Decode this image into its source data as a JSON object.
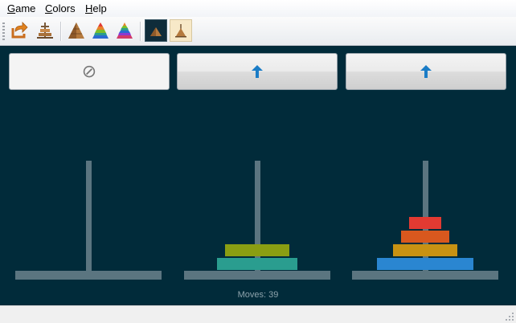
{
  "menu": {
    "items": [
      {
        "accel": "G",
        "rest": "ame"
      },
      {
        "accel": "C",
        "rest": "olors"
      },
      {
        "accel": "H",
        "rest": "elp"
      }
    ]
  },
  "toolbar": {
    "buttons": [
      "undo-icon",
      "add-disk-icon",
      "brown-pyramid-icon",
      "blue-rainbow-pyramid-icon",
      "rainbow-pyramid-icon",
      "dark-theme-icon",
      "light-theme-icon"
    ],
    "selected_theme": "dark-theme-icon"
  },
  "game": {
    "peg_buttons": [
      {
        "state": "disabled",
        "icon": "no-entry-icon",
        "symbol": "⊘"
      },
      {
        "state": "enabled",
        "icon": "arrow-up-icon",
        "symbol": "↑"
      },
      {
        "state": "enabled",
        "icon": "arrow-up-icon",
        "symbol": "↑"
      }
    ],
    "pegs": [
      {
        "disks": []
      },
      {
        "disks": [
          {
            "size": 5,
            "color": "#2a9d8f"
          },
          {
            "size": 4,
            "color": "#8a9e12"
          }
        ]
      },
      {
        "disks": [
          {
            "size": 6,
            "color": "#2a86d1"
          },
          {
            "size": 4,
            "color": "#c89213"
          },
          {
            "size": 3,
            "color": "#d8581e"
          },
          {
            "size": 2,
            "color": "#e23a32"
          }
        ]
      }
    ],
    "moves_label": "Moves: 39"
  },
  "colors": {
    "board": "#012b3a",
    "pole": "#5b7580",
    "arrow": "#1a7cc6"
  }
}
